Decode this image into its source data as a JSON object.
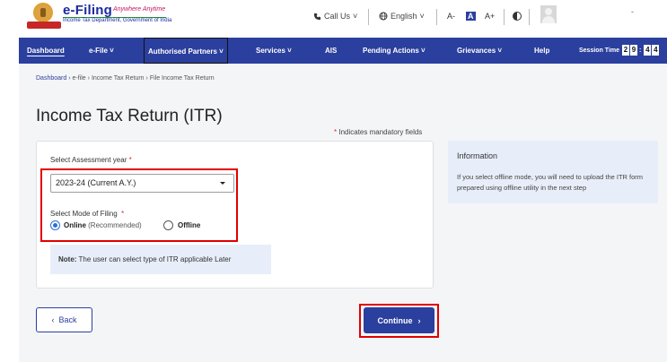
{
  "header": {
    "logo_title": "e-Filing",
    "logo_tagline": "Anywhere Anytime",
    "logo_subtitle": "Income Tax Department, Government of India",
    "call_us": "Call Us",
    "language": "English",
    "font_small": "A-",
    "font_normal": "A",
    "font_large": "A+",
    "tick": "-",
    "icons": [
      "phone-icon",
      "globe-icon",
      "contrast-icon",
      "avatar-icon"
    ]
  },
  "nav": {
    "items": [
      {
        "label": "Dashboard"
      },
      {
        "label": "e-File ˅"
      },
      {
        "label": "Authorised Partners ˅"
      },
      {
        "label": "Services ˅"
      },
      {
        "label": "AIS"
      },
      {
        "label": "Pending Actions ˅"
      },
      {
        "label": "Grievances ˅"
      },
      {
        "label": "Help"
      }
    ],
    "session_label": "Session Time",
    "session_digits": [
      "2",
      "9",
      ":",
      "4",
      "4"
    ],
    "accent": "#2b3f9e"
  },
  "breadcrumb": {
    "items": [
      "Dashboard",
      "e-file",
      "Income Tax Return",
      "File Income Tax Return"
    ],
    "sep": "›"
  },
  "page": {
    "title": "Income Tax Return (ITR)",
    "mandatory_star": "*",
    "mandatory_text": "Indicates mandatory fields"
  },
  "form": {
    "year_label": "Select Assessment year",
    "year_value": "2023-24 (Current A.Y.)",
    "mode_label": "Select Mode of Filing",
    "required_star": "*",
    "online_label": "Online",
    "online_note": "(Recommended)",
    "offline_label": "Offline",
    "selected_mode": "Online",
    "note_label": "Note:",
    "note_text": "The user can select type of ITR applicable Later"
  },
  "info": {
    "title": "Information",
    "text": "If you select offline mode, you will need to upload the ITR form prepared using offline utility in the next step"
  },
  "actions": {
    "back_label": "Back",
    "continue_label": "Continue"
  },
  "colors": {
    "highlight": "#e00000",
    "radio_selected": "#2b6fd6",
    "info_bg": "#e8eef9"
  }
}
